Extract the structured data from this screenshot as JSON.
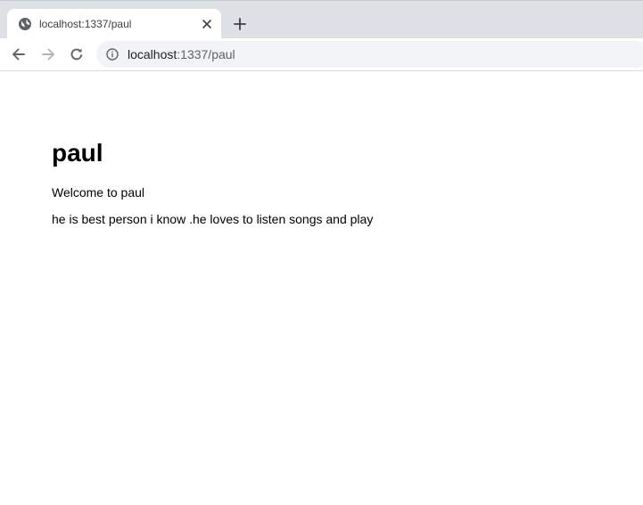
{
  "browser": {
    "tab": {
      "title": "localhost:1337/paul",
      "favicon": "globe-icon",
      "close_icon": "close-icon"
    },
    "new_tab_icon": "plus-icon",
    "toolbar": {
      "back_icon": "arrow-left-icon",
      "forward_icon": "arrow-right-icon",
      "reload_icon": "reload-icon",
      "site_info_icon": "info-icon"
    },
    "address_bar": {
      "host": "localhost",
      "path": ":1337/paul"
    },
    "colors": {
      "tabstrip": "#dee1e6",
      "omnibox": "#f1f3f4",
      "icon": "#5f6368",
      "icon_disabled": "#b0b3b7"
    }
  },
  "page": {
    "heading": "paul",
    "welcome": "Welcome to paul",
    "description": "he is best person i know .he loves to listen songs and play"
  }
}
